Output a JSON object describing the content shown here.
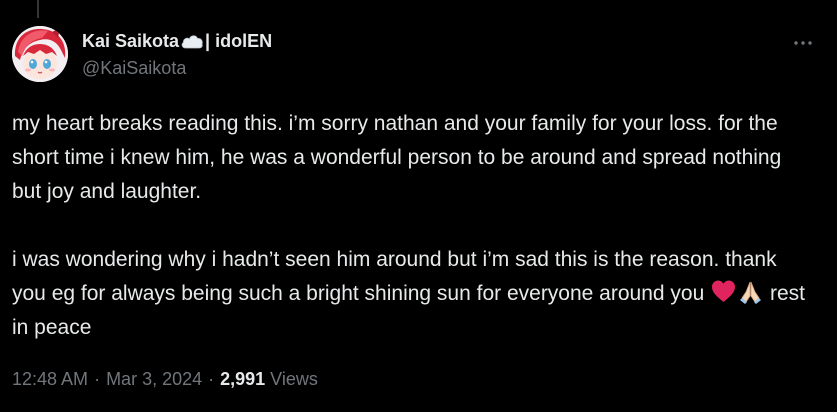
{
  "author": {
    "display_name": "Kai Saikota",
    "name_suffix": "| idolEN",
    "handle": "@KaiSaikota",
    "name_emoji_icon": "cloud-icon",
    "avatar_icon": "avatar-anime-girl-red-hair"
  },
  "tweet": {
    "paragraph_1": "my heart breaks reading this. i’m sorry nathan and your family for your loss. for the short time i knew him, he was a wonderful person to be around and spread nothing but joy and laughter.",
    "paragraph_2_text": "i was wondering why i hadn’t seen him around but i’m sad this is the reason. thank you eg for always being such a bright shining sun for everyone around you",
    "paragraph_2_end": "rest in peace",
    "emojis": [
      "red-heart-icon",
      "folded-hands-icon"
    ]
  },
  "meta": {
    "time": "12:48 AM",
    "separator": "·",
    "date": "Mar 3, 2024",
    "views_count": "2,991",
    "views_label": "Views"
  },
  "more_icon": "more-horizontal-icon",
  "colors": {
    "background": "#000000",
    "text": "#e7e9ea",
    "muted": "#71767b",
    "heart": "#e0245e"
  }
}
